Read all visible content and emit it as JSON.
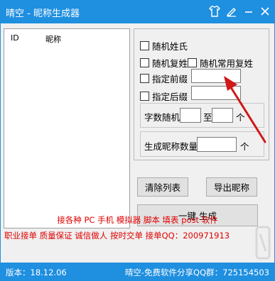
{
  "window": {
    "title": "晴空 - 昵称生成器"
  },
  "titlebar_icons": [
    "shirt-icon",
    "edit-icon",
    "minimize-icon",
    "close-icon"
  ],
  "list": {
    "columns": [
      "ID",
      "昵称"
    ],
    "rows": []
  },
  "options": {
    "random_surname": "随机姓氏",
    "random_double_surname": "随机复姓",
    "random_common_double_surname": "随机常用复姓",
    "prefix_label": "指定前缀",
    "prefix_value": "",
    "suffix_label": "指定后缀",
    "suffix_value": ""
  },
  "length": {
    "label": "字数随机",
    "from": "",
    "to_label": "至",
    "to": "",
    "unit": "个"
  },
  "count": {
    "label": "生成昵称数量",
    "value": "",
    "unit": "个"
  },
  "buttons": {
    "clear": "清除列表",
    "export": "导出昵称",
    "generate": "一键 生成"
  },
  "promo": {
    "line1": "接各种 PC 手机 模拟器 脚本 填表 post 软件",
    "line2": "职业接单 质量保证 诚信做人 按时交单  接单QQ：200971913"
  },
  "status": {
    "version": "版本：18.12.06",
    "right": "晴空-免费软件分享QQ群：725154503"
  },
  "colors": {
    "accent": "#1f8fe0",
    "promo_text": "#e00000",
    "arrow": "#d01818"
  }
}
